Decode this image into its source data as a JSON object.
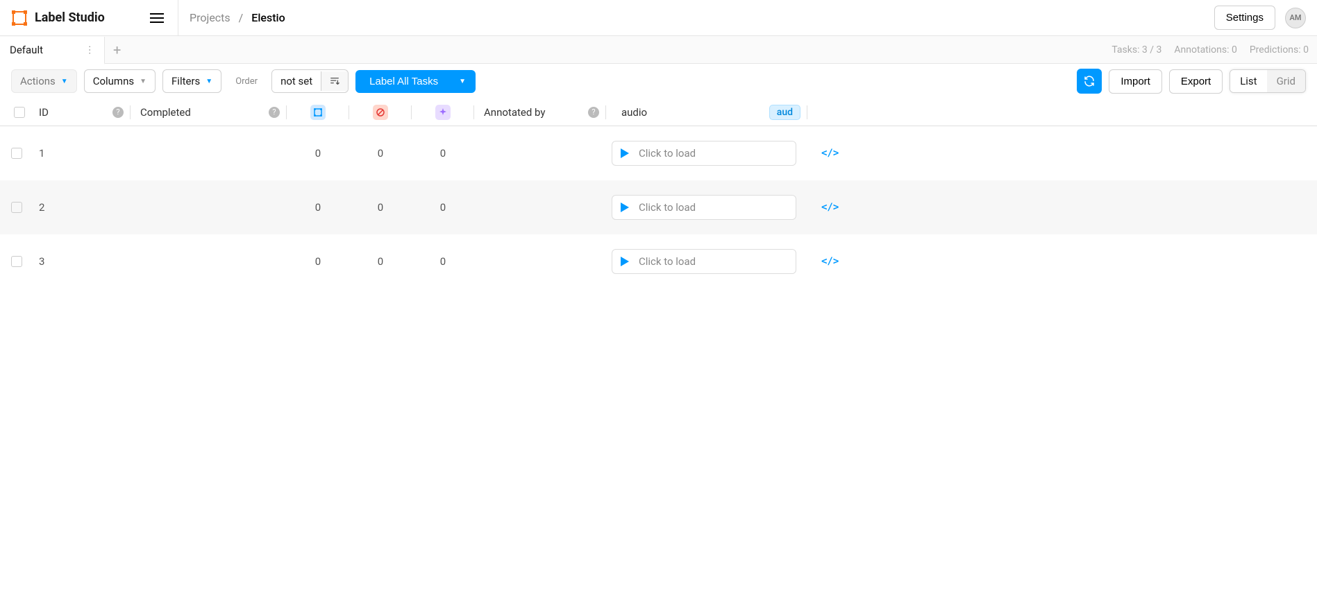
{
  "app": {
    "name": "Label Studio"
  },
  "breadcrumb": {
    "root": "Projects",
    "sep": "/",
    "current": "Elestio"
  },
  "header": {
    "settings": "Settings",
    "avatar_initials": "AM"
  },
  "tabs": {
    "active": "Default",
    "stats_tasks": "Tasks: 3 / 3",
    "stats_annotations": "Annotations: 0",
    "stats_predictions": "Predictions: 0"
  },
  "toolbar": {
    "actions": "Actions",
    "columns": "Columns",
    "filters": "Filters",
    "order_label": "Order",
    "order_value": "not set",
    "label_all": "Label All Tasks",
    "import": "Import",
    "export": "Export",
    "view_list": "List",
    "view_grid": "Grid"
  },
  "columns": {
    "id": "ID",
    "completed": "Completed",
    "annotated_by": "Annotated by",
    "audio": "audio",
    "audio_badge": "aud"
  },
  "rows": [
    {
      "id": "1",
      "c1": "0",
      "c2": "0",
      "c3": "0",
      "audio_label": "Click to load"
    },
    {
      "id": "2",
      "c1": "0",
      "c2": "0",
      "c3": "0",
      "audio_label": "Click to load"
    },
    {
      "id": "3",
      "c1": "0",
      "c2": "0",
      "c3": "0",
      "audio_label": "Click to load"
    }
  ]
}
